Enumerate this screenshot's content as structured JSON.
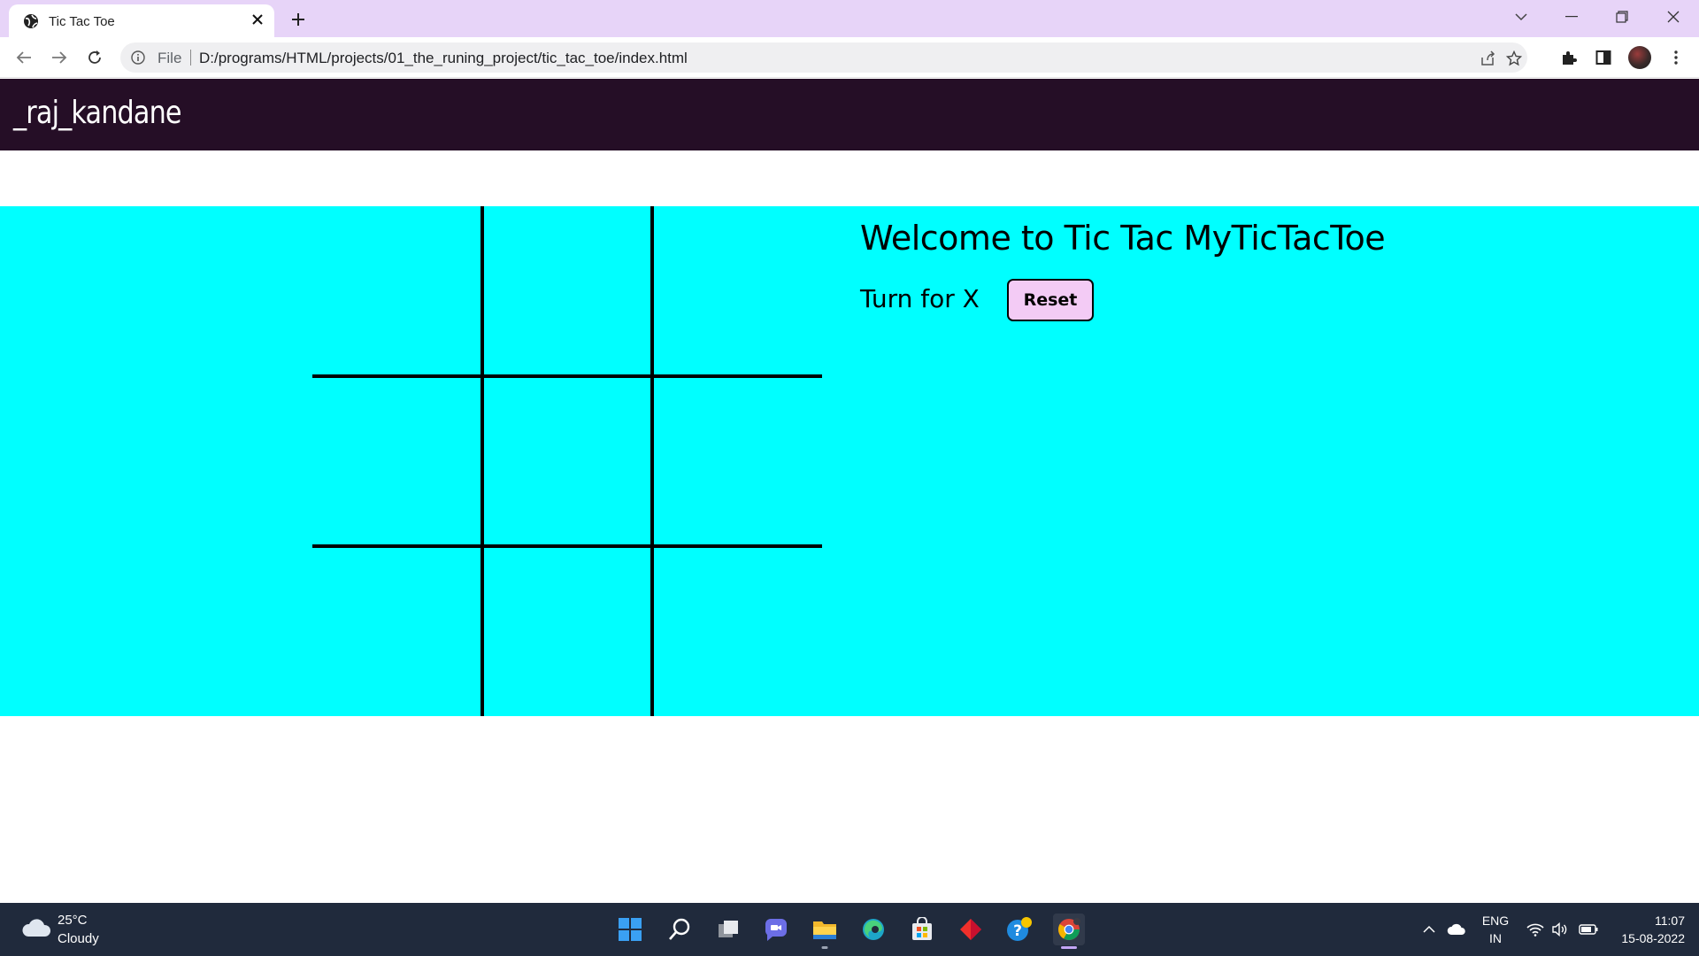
{
  "browser": {
    "tab_title": "Tic Tac Toe",
    "omnibox_scheme": "File",
    "url": "D:/programs/HTML/projects/01_the_runing_project/tic_tac_toe/index.html"
  },
  "site": {
    "brand": "_raj_kandane",
    "welcome": "Welcome to Tic Tac MyTicTacToe",
    "turn_text": "Turn for X",
    "reset_label": "Reset",
    "board": [
      "",
      "",
      "",
      "",
      "",
      "",
      "",
      "",
      ""
    ],
    "colors": {
      "nav_bg": "#250e26",
      "game_bg": "#00ffff",
      "reset_bg": "#f3cbf5",
      "tabbar_bg": "#e7d4f8",
      "taskbar_bg": "#202a3c"
    }
  },
  "taskbar": {
    "weather_temp": "25°C",
    "weather_desc": "Cloudy",
    "lang_line1": "ENG",
    "lang_line2": "IN",
    "time": "11:07",
    "date": "15-08-2022",
    "apps": [
      "windows-start-icon",
      "search-icon",
      "task-view-icon",
      "teams-chat-icon",
      "file-explorer-icon",
      "edge-icon",
      "microsoft-store-icon",
      "git-client-icon",
      "help-icon",
      "chrome-icon"
    ]
  }
}
